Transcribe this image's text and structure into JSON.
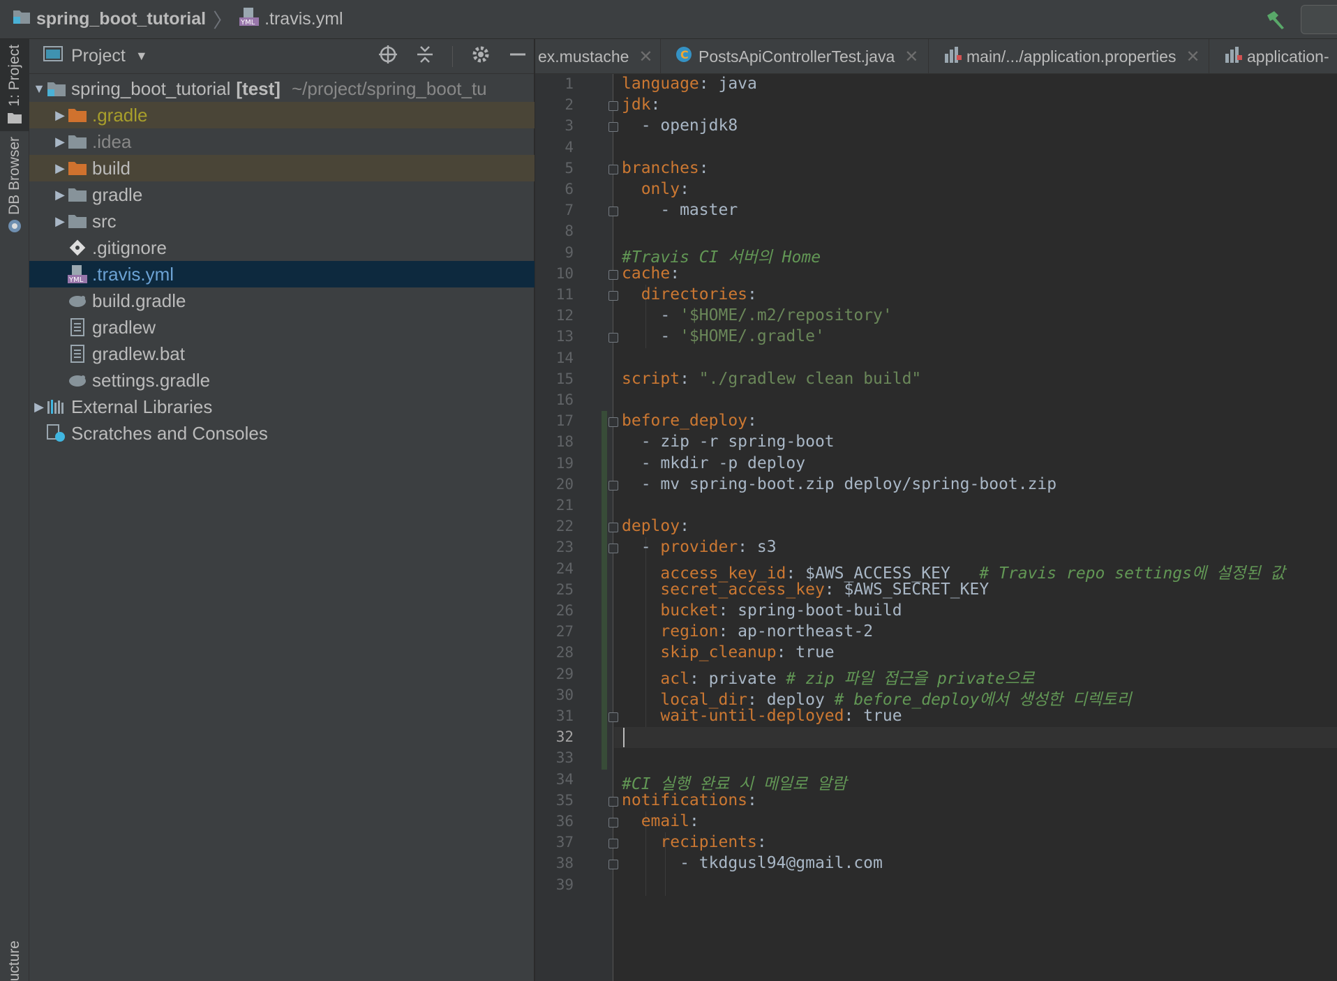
{
  "breadcrumb": {
    "project": "spring_boot_tutorial",
    "file": ".travis.yml"
  },
  "toolstrip": {
    "project_tab": "1: Project",
    "db_browser_tab": "DB Browser",
    "structure_tab": "ucture"
  },
  "project_panel": {
    "title": "Project",
    "root": {
      "name": "spring_boot_tutorial",
      "tag": "[test]",
      "path": "~/project/spring_boot_tu"
    },
    "items": [
      {
        "label": ".gradle"
      },
      {
        "label": ".idea"
      },
      {
        "label": "build"
      },
      {
        "label": "gradle"
      },
      {
        "label": "src"
      },
      {
        "label": ".gitignore"
      },
      {
        "label": ".travis.yml"
      },
      {
        "label": "build.gradle"
      },
      {
        "label": "gradlew"
      },
      {
        "label": "gradlew.bat"
      },
      {
        "label": "settings.gradle"
      },
      {
        "label": "External Libraries"
      },
      {
        "label": "Scratches and Consoles"
      }
    ]
  },
  "tabs": [
    {
      "label": "ex.mustache"
    },
    {
      "label": "PostsApiControllerTest.java"
    },
    {
      "label": "main/.../application.properties"
    },
    {
      "label": "application-"
    }
  ],
  "editor": {
    "current_line": 32,
    "line_numbers": [
      "1",
      "2",
      "3",
      "4",
      "5",
      "6",
      "7",
      "8",
      "9",
      "10",
      "11",
      "12",
      "13",
      "14",
      "15",
      "16",
      "17",
      "18",
      "19",
      "20",
      "21",
      "22",
      "23",
      "24",
      "25",
      "26",
      "27",
      "28",
      "29",
      "30",
      "31",
      "32",
      "33",
      "34",
      "35",
      "36",
      "37",
      "38",
      "39"
    ],
    "lines": [
      [
        {
          "t": "k",
          "v": "language"
        },
        {
          "t": "p",
          "v": ": java"
        }
      ],
      [
        {
          "t": "k",
          "v": "jdk"
        },
        {
          "t": "p",
          "v": ":"
        }
      ],
      [
        {
          "t": "p",
          "v": "  - openjdk8"
        }
      ],
      [],
      [
        {
          "t": "k",
          "v": "branches"
        },
        {
          "t": "p",
          "v": ":"
        }
      ],
      [
        {
          "t": "p",
          "v": "  "
        },
        {
          "t": "k",
          "v": "only"
        },
        {
          "t": "p",
          "v": ":"
        }
      ],
      [
        {
          "t": "p",
          "v": "    - master"
        }
      ],
      [],
      [
        {
          "t": "c",
          "v": "#Travis CI 서버의 Home"
        }
      ],
      [
        {
          "t": "k",
          "v": "cache"
        },
        {
          "t": "p",
          "v": ":"
        }
      ],
      [
        {
          "t": "p",
          "v": "  "
        },
        {
          "t": "k",
          "v": "directories"
        },
        {
          "t": "p",
          "v": ":"
        }
      ],
      [
        {
          "t": "p",
          "v": "    - "
        },
        {
          "t": "s",
          "v": "'$HOME/.m2/repository'"
        }
      ],
      [
        {
          "t": "p",
          "v": "    - "
        },
        {
          "t": "s",
          "v": "'$HOME/.gradle'"
        }
      ],
      [],
      [
        {
          "t": "k",
          "v": "script"
        },
        {
          "t": "p",
          "v": ": "
        },
        {
          "t": "s",
          "v": "\"./gradlew clean build\""
        }
      ],
      [],
      [
        {
          "t": "k",
          "v": "before_deploy"
        },
        {
          "t": "p",
          "v": ":"
        }
      ],
      [
        {
          "t": "p",
          "v": "  - zip -r spring-boot"
        }
      ],
      [
        {
          "t": "p",
          "v": "  - mkdir -p deploy"
        }
      ],
      [
        {
          "t": "p",
          "v": "  - mv spring-boot.zip deploy/spring-boot.zip"
        }
      ],
      [],
      [
        {
          "t": "k",
          "v": "deploy"
        },
        {
          "t": "p",
          "v": ":"
        }
      ],
      [
        {
          "t": "p",
          "v": "  - "
        },
        {
          "t": "k",
          "v": "provider"
        },
        {
          "t": "p",
          "v": ": s3"
        }
      ],
      [
        {
          "t": "p",
          "v": "    "
        },
        {
          "t": "k",
          "v": "access_key_id"
        },
        {
          "t": "p",
          "v": ": $AWS_ACCESS_KEY   "
        },
        {
          "t": "c",
          "v": "# Travis repo settings에 설정된 값"
        }
      ],
      [
        {
          "t": "p",
          "v": "    "
        },
        {
          "t": "k",
          "v": "secret_access_key"
        },
        {
          "t": "p",
          "v": ": $AWS_SECRET_KEY"
        }
      ],
      [
        {
          "t": "p",
          "v": "    "
        },
        {
          "t": "k",
          "v": "bucket"
        },
        {
          "t": "p",
          "v": ": spring-boot-build"
        }
      ],
      [
        {
          "t": "p",
          "v": "    "
        },
        {
          "t": "k",
          "v": "region"
        },
        {
          "t": "p",
          "v": ": ap-northeast-2"
        }
      ],
      [
        {
          "t": "p",
          "v": "    "
        },
        {
          "t": "k",
          "v": "skip_cleanup"
        },
        {
          "t": "p",
          "v": ": true"
        }
      ],
      [
        {
          "t": "p",
          "v": "    "
        },
        {
          "t": "k",
          "v": "acl"
        },
        {
          "t": "p",
          "v": ": private "
        },
        {
          "t": "c",
          "v": "# zip 파일 접근을 private으로"
        }
      ],
      [
        {
          "t": "p",
          "v": "    "
        },
        {
          "t": "k",
          "v": "local_dir"
        },
        {
          "t": "p",
          "v": ": deploy "
        },
        {
          "t": "c",
          "v": "# before_deploy에서 생성한 디렉토리"
        }
      ],
      [
        {
          "t": "p",
          "v": "    "
        },
        {
          "t": "k",
          "v": "wait-until-deployed"
        },
        {
          "t": "p",
          "v": ": true"
        }
      ],
      [],
      [],
      [
        {
          "t": "c",
          "v": "#CI 실행 완료 시 메일로 알람"
        }
      ],
      [
        {
          "t": "k",
          "v": "notifications"
        },
        {
          "t": "p",
          "v": ":"
        }
      ],
      [
        {
          "t": "p",
          "v": "  "
        },
        {
          "t": "k",
          "v": "email"
        },
        {
          "t": "p",
          "v": ":"
        }
      ],
      [
        {
          "t": "p",
          "v": "    "
        },
        {
          "t": "k",
          "v": "recipients"
        },
        {
          "t": "p",
          "v": ":"
        }
      ],
      [
        {
          "t": "p",
          "v": "      - tkdgusl94@gmail.com"
        }
      ],
      []
    ]
  },
  "colors": {
    "keyword": "#cc7832",
    "string": "#6a8759",
    "comment": "#629755",
    "plain": "#a9b7c6",
    "selection": "#0d293e",
    "excluded_folder": "#4a4537"
  }
}
